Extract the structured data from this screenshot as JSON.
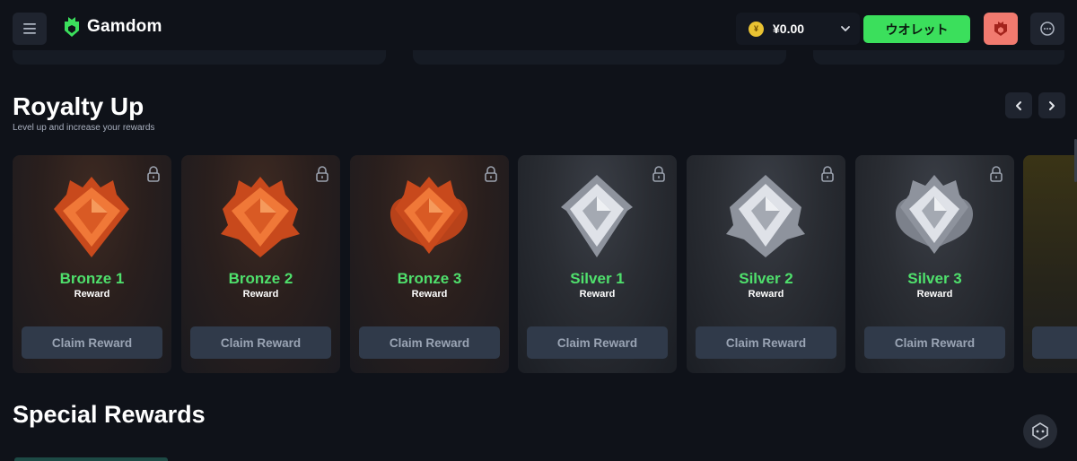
{
  "header": {
    "logo_text": "Gamdom",
    "balance_amount": "¥0.00",
    "wallet_label": "ウオレット",
    "icons": [
      "hamburger-menu-icon",
      "gamdom-logo-icon",
      "coin-icon",
      "chevron-down-icon",
      "avatar-icon",
      "chat-bubble-icon"
    ],
    "colors": {
      "accent": "#3bdf5c",
      "avatar_bg": "#f17a6f",
      "coin": "#e9c232"
    }
  },
  "royalty": {
    "title": "Royalty Up",
    "subtitle": "Level up and increase your rewards",
    "tiers": [
      {
        "name": "Bronze 1",
        "reward": "Reward",
        "claim": "Claim Reward",
        "badge": "bronze-1-badge-icon",
        "locked": true
      },
      {
        "name": "Bronze 2",
        "reward": "Reward",
        "claim": "Claim Reward",
        "badge": "bronze-2-badge-icon",
        "locked": true
      },
      {
        "name": "Bronze 3",
        "reward": "Reward",
        "claim": "Claim Reward",
        "badge": "bronze-3-badge-icon",
        "locked": true
      },
      {
        "name": "Silver 1",
        "reward": "Reward",
        "claim": "Claim Reward",
        "badge": "silver-1-badge-icon",
        "locked": true
      },
      {
        "name": "Silver 2",
        "reward": "Reward",
        "claim": "Claim Reward",
        "badge": "silver-2-badge-icon",
        "locked": true
      },
      {
        "name": "Silver 3",
        "reward": "Reward",
        "claim": "Claim Reward",
        "badge": "silver-3-badge-icon",
        "locked": true
      }
    ],
    "colors": {
      "tier_name": "#4fe06c",
      "bronze": "#e8612a",
      "silver": "#c9ccd3"
    }
  },
  "special": {
    "title": "Special Rewards"
  }
}
